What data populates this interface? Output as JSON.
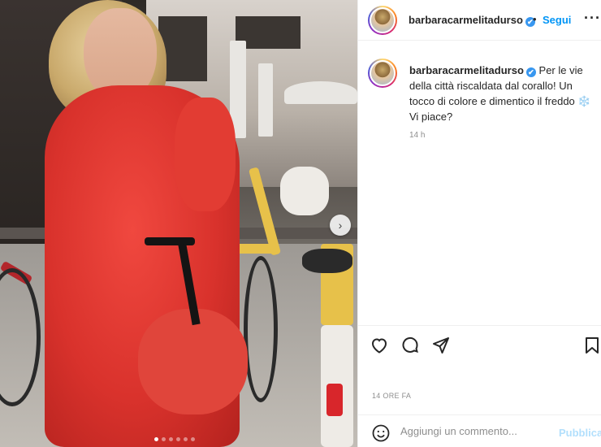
{
  "post": {
    "username": "barbaracarmelitadurso",
    "verified_mark": "✔",
    "separator": "•",
    "follow_label": "Segui",
    "more_label": "···",
    "caption": "Per le vie della città riscaldata dal corallo! Un tocco di colore e dimentico il freddo",
    "caption_emoji": "❄️",
    "caption_end": "Vi piace?",
    "relative_time": "14 h",
    "post_date": "14 ORE FA",
    "carousel_next": "›",
    "carousel_slide_count": 6,
    "carousel_active_slide": 1
  },
  "comment": {
    "placeholder": "Aggiungi un commento...",
    "publish_label": "Pubblica"
  },
  "icons": {
    "like": "heart-icon",
    "comment": "comment-icon",
    "share": "share-icon",
    "save": "bookmark-icon",
    "emoji": "emoji-icon"
  },
  "colors": {
    "follow": "#0095f6",
    "publish_disabled": "#b2dffc",
    "verified": "#3897f0",
    "coat_red": "#d9322c"
  }
}
